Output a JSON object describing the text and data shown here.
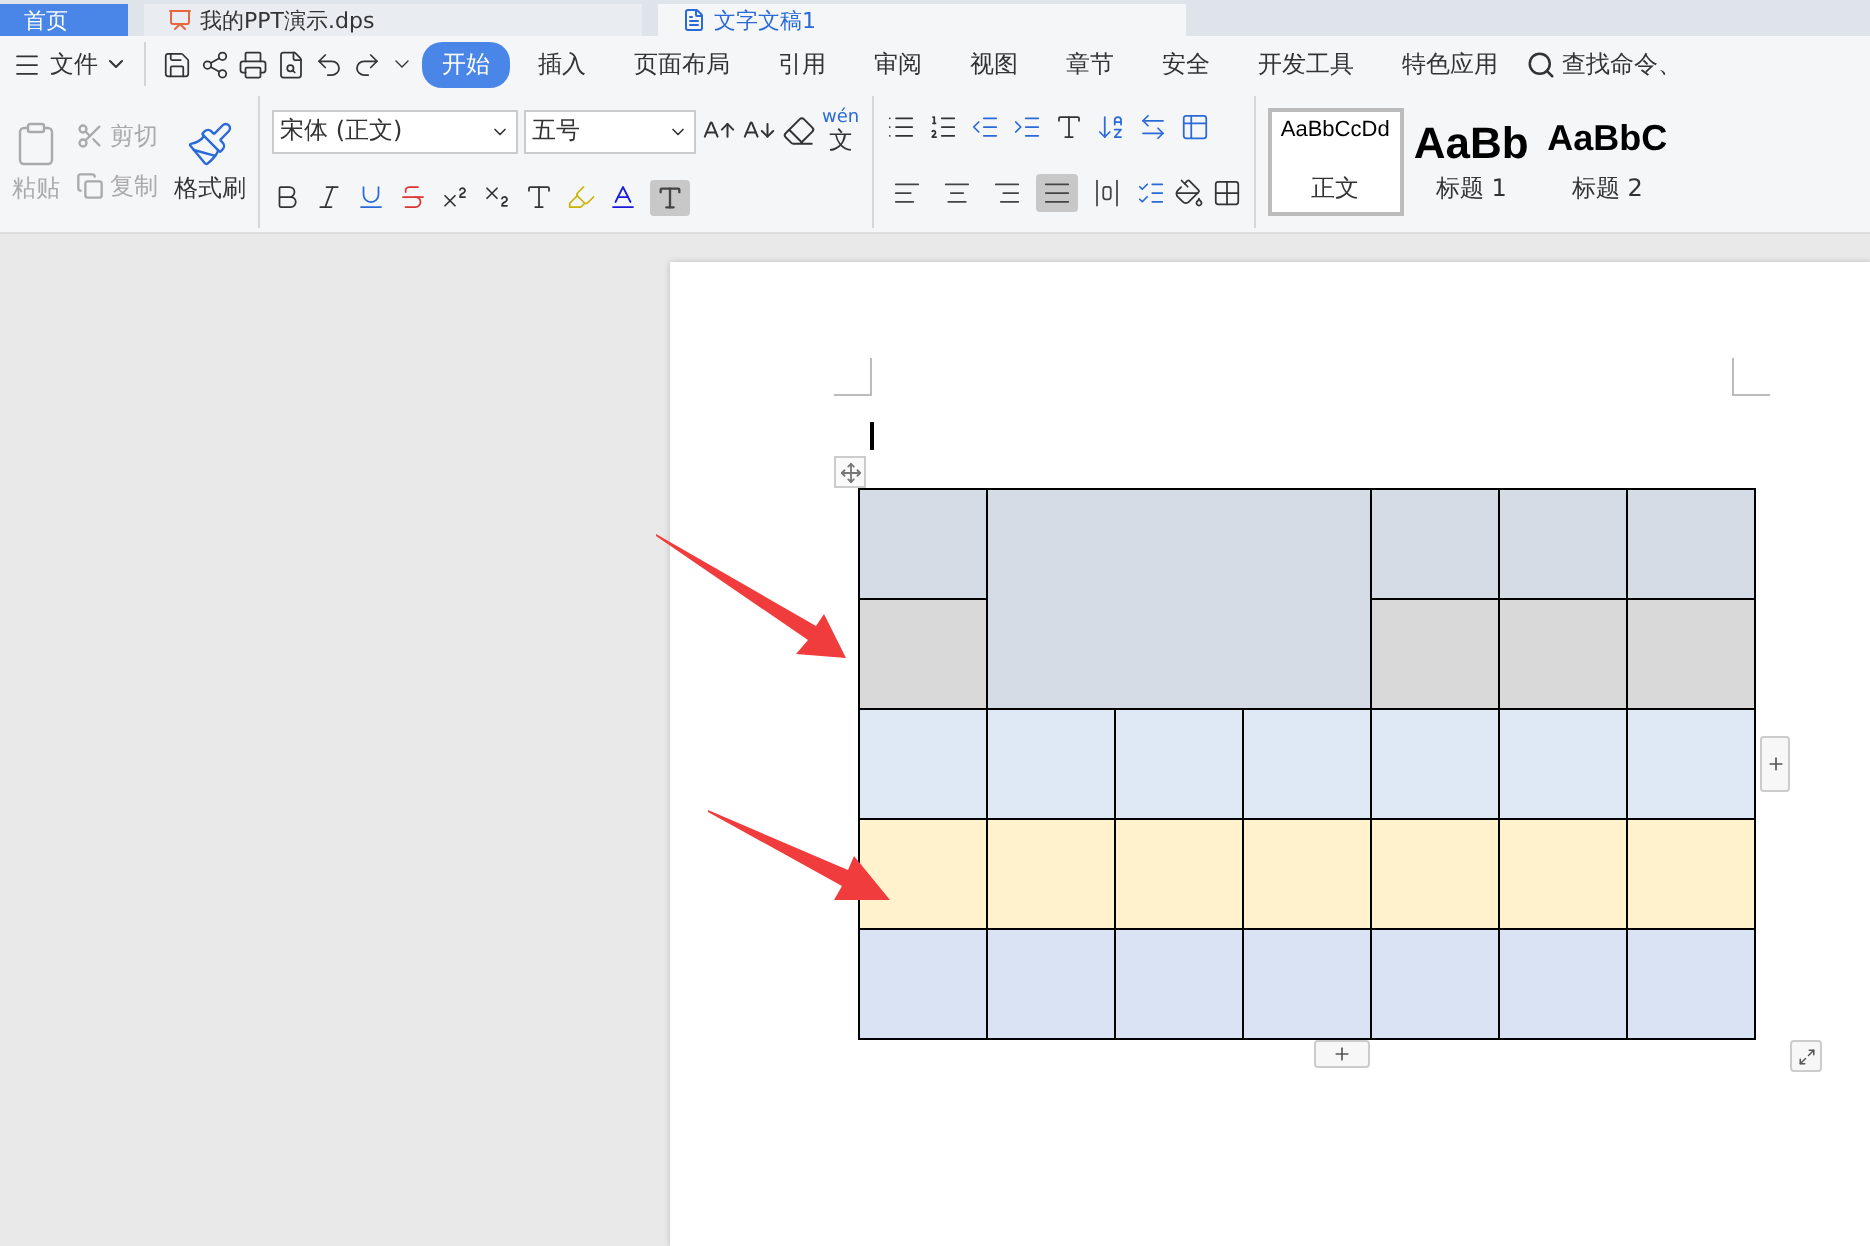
{
  "tabs": [
    {
      "label": "首页",
      "kind": "home",
      "selected": false
    },
    {
      "label": "我的PPT演示.dps",
      "kind": "presentation",
      "selected": false
    },
    {
      "label": "文字文稿1",
      "kind": "writer",
      "selected": true
    }
  ],
  "menu": {
    "file": "文件",
    "items": [
      {
        "label": "开始",
        "selected": true
      },
      {
        "label": "插入",
        "selected": false
      },
      {
        "label": "页面布局",
        "selected": false
      },
      {
        "label": "引用",
        "selected": false
      },
      {
        "label": "审阅",
        "selected": false
      },
      {
        "label": "视图",
        "selected": false
      },
      {
        "label": "章节",
        "selected": false
      },
      {
        "label": "安全",
        "selected": false
      },
      {
        "label": "开发工具",
        "selected": false
      },
      {
        "label": "特色应用",
        "selected": false
      }
    ],
    "search": "查找命令、"
  },
  "clipboard": {
    "paste": {
      "label": "粘贴",
      "disabled": true
    },
    "cut": {
      "label": "剪切",
      "disabled": true
    },
    "copy": {
      "label": "复制",
      "disabled": true
    },
    "format_painter": {
      "label": "格式刷",
      "disabled": false
    }
  },
  "font": {
    "name": "宋体 (正文)",
    "size": "五号",
    "pinyin_top": "wén",
    "pinyin_bottom": "文"
  },
  "alignment": [
    {
      "kind": "left",
      "selected": false
    },
    {
      "kind": "center",
      "selected": false
    },
    {
      "kind": "right",
      "selected": false
    },
    {
      "kind": "justify",
      "selected": true
    },
    {
      "kind": "distributed",
      "selected": false
    }
  ],
  "styles": [
    {
      "preview": "AaBbCcDd",
      "label": "正文",
      "kind": "body",
      "selected": true
    },
    {
      "preview": "AaBb",
      "label": "标题 1",
      "kind": "h1",
      "selected": false
    },
    {
      "preview": "AaBbC",
      "label": "标题 2",
      "kind": "h2",
      "selected": false
    }
  ],
  "table": {
    "rows": [
      {
        "kind": "merged-top",
        "color": "#d6dce5"
      },
      {
        "kind": "merged-under",
        "color": "#d9d9d9"
      },
      {
        "kind": "full",
        "color": "#dee9f5"
      },
      {
        "kind": "full",
        "color": "#fff2cc"
      },
      {
        "kind": "full",
        "color": "#dae3f3"
      }
    ]
  }
}
